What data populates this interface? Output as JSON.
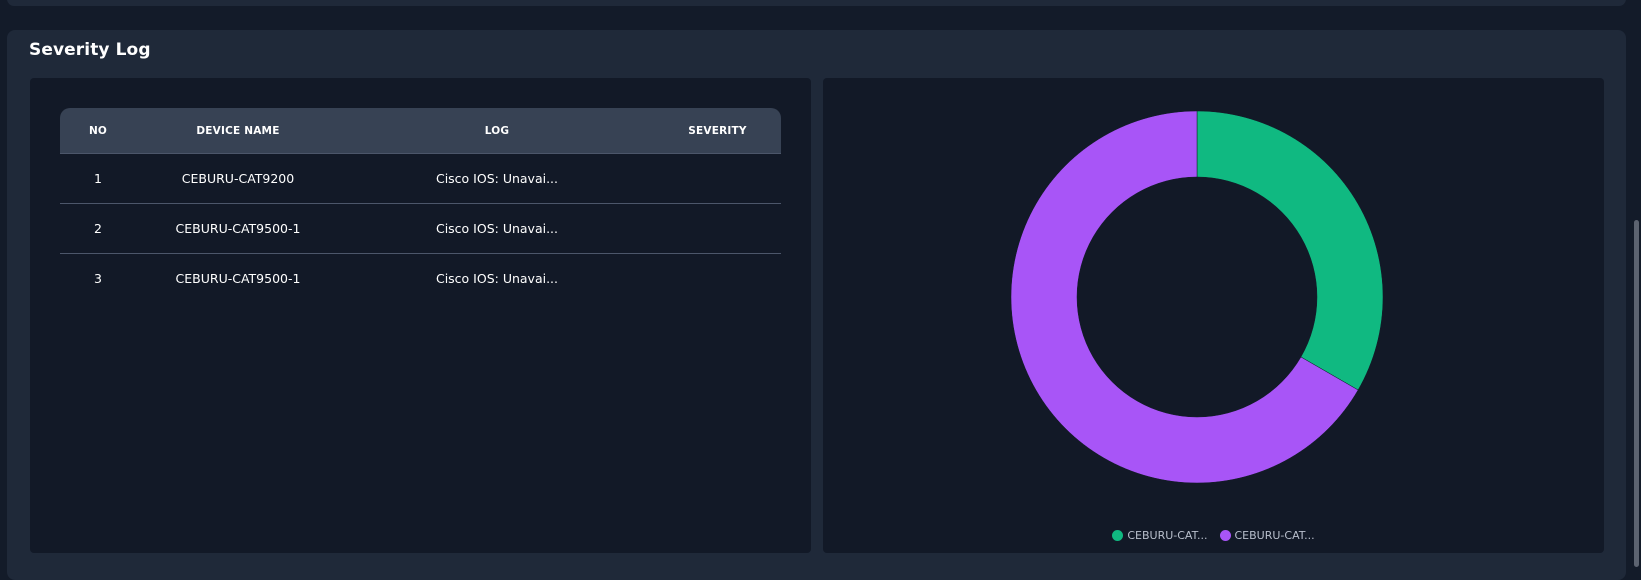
{
  "panel": {
    "title": "Severity Log"
  },
  "table": {
    "headers": {
      "no": "NO",
      "device": "DEVICE NAME",
      "log": "LOG",
      "severity": "SEVERITY"
    },
    "rows": [
      {
        "no": "1",
        "device": "CEBURU-CAT9200",
        "log": "Cisco IOS: Unavai...",
        "severity": ""
      },
      {
        "no": "2",
        "device": "CEBURU-CAT9500-1",
        "log": "Cisco IOS: Unavai...",
        "severity": ""
      },
      {
        "no": "3",
        "device": "CEBURU-CAT9500-1",
        "log": "Cisco IOS: Unavai...",
        "severity": ""
      }
    ]
  },
  "colors": {
    "series_1": "#10b981",
    "series_2": "#a855f7"
  },
  "chart_data": {
    "type": "pie",
    "variant": "donut",
    "categories": [
      "CEBURU-CAT...",
      "CEBURU-CAT..."
    ],
    "values": [
      1,
      2
    ],
    "colors": [
      "#10b981",
      "#a855f7"
    ],
    "legend_position": "bottom"
  }
}
